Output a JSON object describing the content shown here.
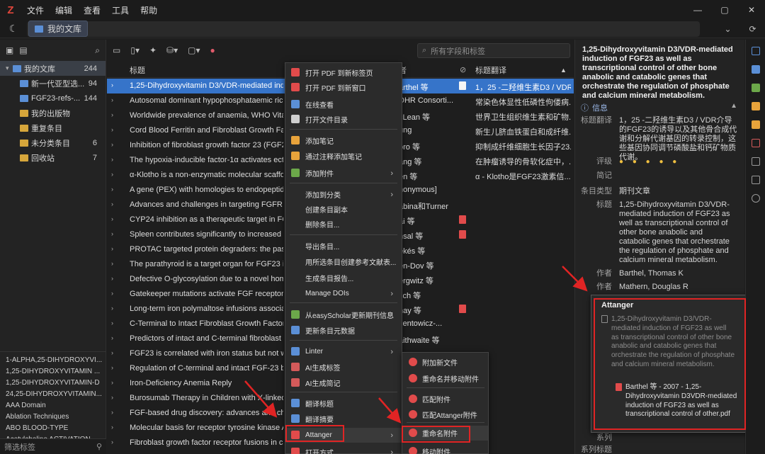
{
  "titlebar": {
    "logo": "Z",
    "menu": [
      "文件",
      "编辑",
      "查看",
      "工具",
      "帮助"
    ],
    "win_controls": [
      "—",
      "▢",
      "✕"
    ]
  },
  "tabbar": {
    "tab_label": "我的文库"
  },
  "collections": [
    {
      "label": "我的文库",
      "count": "244",
      "selected": true,
      "level": 0,
      "color": "#5b8fd6"
    },
    {
      "label": "新一代亚型选...",
      "count": "94",
      "level": 1,
      "color": "#5b8fd6"
    },
    {
      "label": "FGF23-refs-...",
      "count": "144",
      "level": 1,
      "color": "#5b8fd6"
    },
    {
      "label": "我的出版物",
      "count": "",
      "level": 1,
      "color": "#d6a63b"
    },
    {
      "label": "重复条目",
      "count": "",
      "level": 1,
      "color": "#d6a63b"
    },
    {
      "label": "未分类条目",
      "count": "6",
      "level": 1,
      "color": "#d6a63b"
    },
    {
      "label": "回收站",
      "count": "7",
      "level": 1,
      "color": "#d6a63b"
    }
  ],
  "tags": [
    "1-ALPHA,25-DIHYDROXYVI...",
    "1,25-DIHYDROXYVITAMIN ...",
    "1,25-DIHYDROXYVITAMIN-D",
    "24,25-DIHYDROXYVITAMIN...",
    "AAA Domain",
    "Ablation Techniques",
    "ABO BLOOD-TYPE",
    "Acetylcholine ACTIVATION"
  ],
  "filter_placeholder": "筛选标签",
  "search_placeholder": "所有字段和标签",
  "columns": {
    "title": "标题",
    "author": "者",
    "translation": "标题翻译"
  },
  "items": [
    {
      "title": "1,25-Dihydroxyvitamin D3/VDR-mediated indu",
      "author": "arthel 等",
      "pdf": "white",
      "trans": "1，25 -二羟维生素D3 / VDR..."
    },
    {
      "title": "Autosomal dominant hypophosphataemic rick",
      "author": "DHR Consorti...",
      "pdf": "",
      "trans": "常染色体显性低磷性佝偻病..."
    },
    {
      "title": "Worldwide prevalence of anaemia, WHO Vitam",
      "author": "cLean 等",
      "pdf": "",
      "trans": "世界卫生组织维生素和矿物..."
    },
    {
      "title": "Cord Blood Ferritin and Fibroblast Growth Fact",
      "author": "ung",
      "pdf": "",
      "trans": "新生儿脐血铁蛋白和成纤维..."
    },
    {
      "title": "Inhibition of fibroblast growth factor 23 (FGF23",
      "author": "oro 等",
      "pdf": "",
      "trans": "抑制成纤维细胞生长因子23..."
    },
    {
      "title": "The hypoxia-inducible factor-1α activates ecto",
      "author": "ang 等",
      "pdf": "",
      "trans": "在肿瘤诱导的骨软化症中，..."
    },
    {
      "title": "α-Klotho is a non-enzymatic molecular scaffold",
      "author": "en 等",
      "pdf": "",
      "trans": "α - Klotho是FGF23激素信..."
    },
    {
      "title": "A gene (PEX) with homologies to endopeptida",
      "author": "nonymous]",
      "pdf": "",
      "trans": ""
    },
    {
      "title": "Advances and challenges in targeting FGFR sig",
      "author": "abina和Turner",
      "pdf": "",
      "trans": ""
    },
    {
      "title": "CYP24 inhibition as a therapeutic target in FGF",
      "author": "ai 等",
      "pdf": "red",
      "trans": ""
    },
    {
      "title": "Spleen contributes significantly to increased ci",
      "author": "nsal 等",
      "pdf": "red",
      "trans": ""
    },
    {
      "title": "PROTAC targeted protein degraders: the past is",
      "author": "ekés 等",
      "pdf": "",
      "trans": ""
    },
    {
      "title": "The parathyroid is a target organ for FGF23 in",
      "author": "en-Dov 等",
      "pdf": "",
      "trans": ""
    },
    {
      "title": "Defective O-glycosylation due to a novel homo",
      "author": "ergwitz 等",
      "pdf": "",
      "trans": ""
    },
    {
      "title": "Gatekeeper mutations activate FGF receptor ty",
      "author": "sch 等",
      "pdf": "",
      "trans": ""
    },
    {
      "title": "Long-term iron polymaltose infusions associat",
      "author": "hay 等",
      "pdf": "red",
      "trans": ""
    },
    {
      "title": "C-Terminal to Intact Fibroblast Growth Factor 2",
      "author": "zentowicz-...",
      "pdf": "",
      "trans": ""
    },
    {
      "title": "Predictors of intact and C-terminal fibroblast g",
      "author": "aithwaite 等",
      "pdf": "",
      "trans": ""
    },
    {
      "title": "FGF23 is correlated with iron status but not wit",
      "author": "",
      "pdf": "",
      "trans": ""
    },
    {
      "title": "Regulation of C-terminal and intact FGF-23 by",
      "author": "",
      "pdf": "",
      "trans": ""
    },
    {
      "title": "Iron-Deficiency Anemia Reply",
      "author": "",
      "pdf": "",
      "trans": ""
    },
    {
      "title": "Burosumab Therapy in Children with X-linked",
      "author": "",
      "pdf": "",
      "trans": ""
    },
    {
      "title": "FGF-based drug discovery: advances and challe",
      "author": "",
      "pdf": "",
      "trans": ""
    },
    {
      "title": "Molecular basis for receptor tyrosine kinase A-",
      "author": "",
      "pdf": "",
      "trans": ""
    },
    {
      "title": "Fibroblast growth factor receptor fusions in ca",
      "author": "",
      "pdf": "",
      "trans": ""
    }
  ],
  "context_menu": [
    {
      "label": "打开 PDF 到新标签页",
      "color": "#e14b4b",
      "sub": false
    },
    {
      "label": "打开 PDF 到新窗口",
      "color": "#e14b4b",
      "sub": false
    },
    {
      "label": "在线查看",
      "color": "#5b8fd6",
      "sub": false
    },
    {
      "label": "打开文件目录",
      "color": "#cfcfcf",
      "sub": false
    },
    {
      "label": "添加笔记",
      "color": "#e8a33b",
      "sub": false
    },
    {
      "label": "通过注释添加笔记",
      "color": "#e8a33b",
      "sub": false
    },
    {
      "label": "添加附件",
      "color": "#6ca84a",
      "sub": true
    },
    {
      "label": "添加到分类",
      "color": "",
      "sub": true
    },
    {
      "label": "创建条目副本",
      "color": "",
      "sub": false
    },
    {
      "label": "删除条目...",
      "color": "",
      "sub": false
    },
    {
      "label": "导出条目...",
      "color": "",
      "sub": false
    },
    {
      "label": "用所选条目创建参考文献表...",
      "color": "",
      "sub": false
    },
    {
      "label": "生成条目报告...",
      "color": "",
      "sub": false
    },
    {
      "label": "Manage DOIs",
      "color": "",
      "sub": true
    },
    {
      "label": "从easyScholar更新期刊信息",
      "color": "#6ca84a",
      "sub": false
    },
    {
      "label": "更新条目元数据",
      "color": "#5b8fd6",
      "sub": false
    },
    {
      "label": "Linter",
      "color": "#5b8fd6",
      "sub": true
    },
    {
      "label": "AI生成标签",
      "color": "#d45a5a",
      "sub": false
    },
    {
      "label": "AI生成简记",
      "color": "#d45a5a",
      "sub": false
    },
    {
      "label": "翻译标题",
      "color": "#5b8fd6",
      "sub": false
    },
    {
      "label": "翻译摘要",
      "color": "#5b8fd6",
      "sub": false
    },
    {
      "label": "Attanger",
      "color": "#e14b4b",
      "sub": true
    },
    {
      "label": "打开方式",
      "color": "#e14b4b",
      "sub": true
    }
  ],
  "submenu": [
    "附加新文件",
    "重命名并移动附件",
    "匹配附件",
    "匹配Attanger附件",
    "重命名附件",
    "移动附件"
  ],
  "detail": {
    "heading": "1,25-Dihydroxyvitamin D3/VDR-mediated induction of FGF23 as well as transcriptional control of other bone anabolic and catabolic genes that orchestrate the regulation of phosphate and calcium mineral metabolism.",
    "section_label": "信息",
    "fields": {
      "trans_label": "标题翻译",
      "trans_value": "1，25 -二羟维生素D3 / VDR介导的FGF23的诱导以及其他骨合成代谢和分解代谢基因的转录控制，这些基因协同调节磷酸盐和钙矿物质代谢。",
      "rating_label": "评级",
      "rating_value": "● ● ● ● ●",
      "note_label": "简记",
      "type_label": "条目类型",
      "type_value": "期刊文章",
      "title_label": "标题",
      "title_value": "1,25-Dihydroxyvitamin D3/VDR-mediated induction of FGF23 as well as transcriptional control of other bone anabolic and catabolic genes that orchestrate the regulation of phosphate and calcium mineral metabolism.",
      "author_label": "作者",
      "author1": "Barthel, Thomas K",
      "author2": "Mathern, Douglas R",
      "series_label": "系列",
      "series_title_label": "系列标题"
    }
  },
  "popup": {
    "title": "Attanger",
    "note": "1,25-Dihydroxyvitamin D3/VDR-mediated induction of FGF23 as well as transcriptional control of other bone anabolic and catabolic genes that orchestrate the regulation of phosphate and calcium mineral metabolism.",
    "file": "Barthel 等 - 2007 - 1,25-Dihydroxyvitamin D3VDR-mediated induction of FGF23 as well as transcriptional control of other.pdf"
  }
}
